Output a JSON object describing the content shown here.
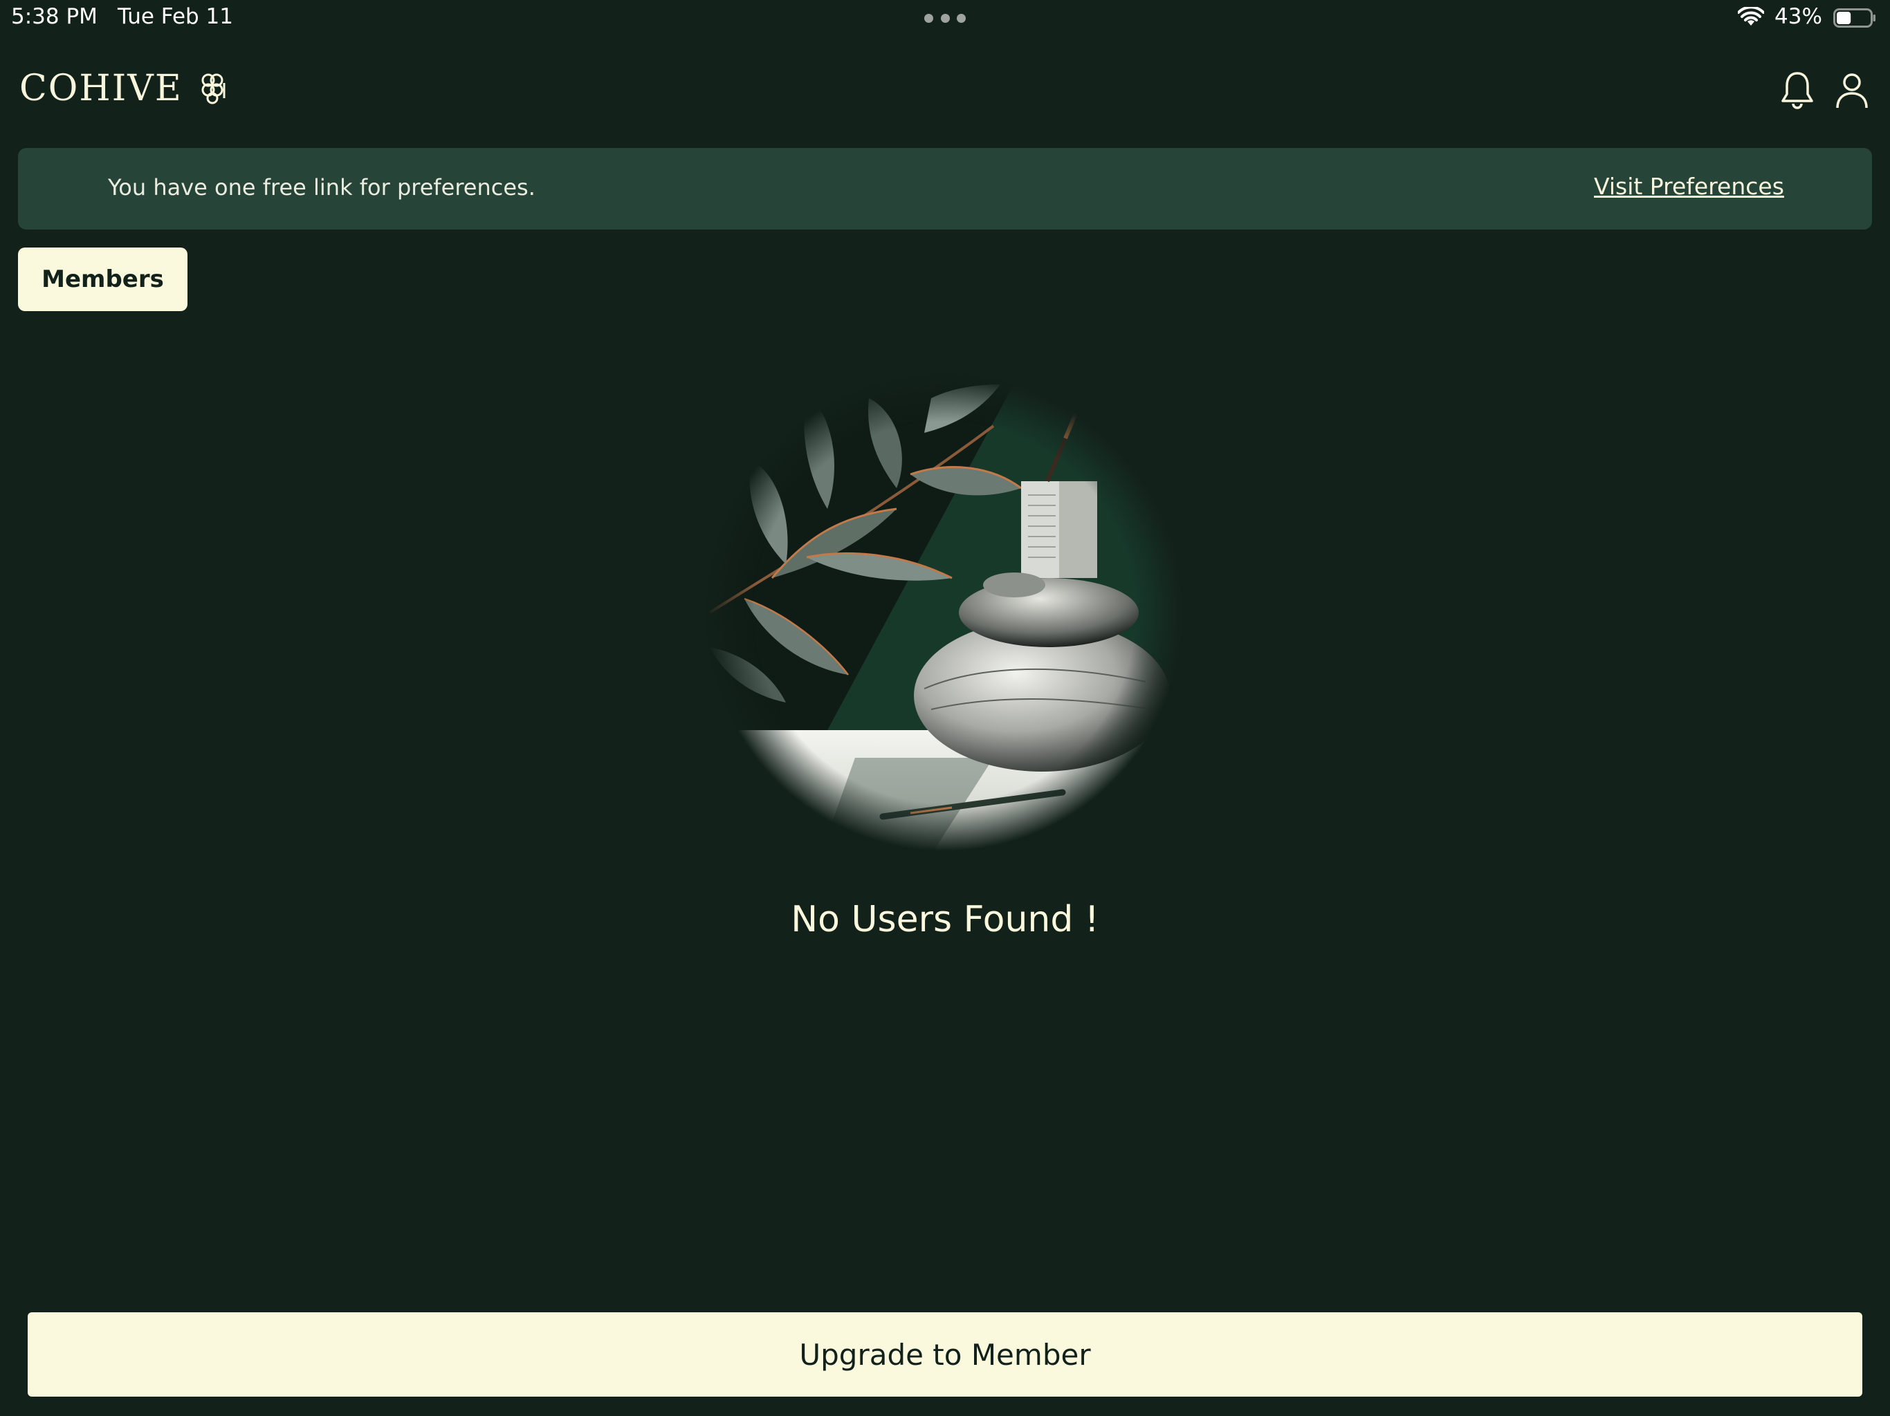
{
  "status_bar": {
    "time": "5:38 PM",
    "date": "Tue Feb 11",
    "battery_percent": "43%",
    "battery_level": 0.43,
    "icons": [
      "more-dots-icon",
      "wifi-icon",
      "battery-icon"
    ]
  },
  "header": {
    "brand": "COHIVE",
    "icons": [
      "cohive-logo-icon",
      "bell-icon",
      "user-icon"
    ]
  },
  "banner": {
    "message": "You have one free link for preferences.",
    "link_label": "Visit Preferences"
  },
  "tabs": {
    "members_label": "Members"
  },
  "empty_state": {
    "title": "No Users Found !",
    "image": "zen-stones-leaves-illustration"
  },
  "footer": {
    "upgrade_label": "Upgrade to Member"
  },
  "colors": {
    "background": "#13211b",
    "banner": "#264438",
    "accent_cream": "#fbf9dd",
    "text_dark": "#13211b"
  }
}
